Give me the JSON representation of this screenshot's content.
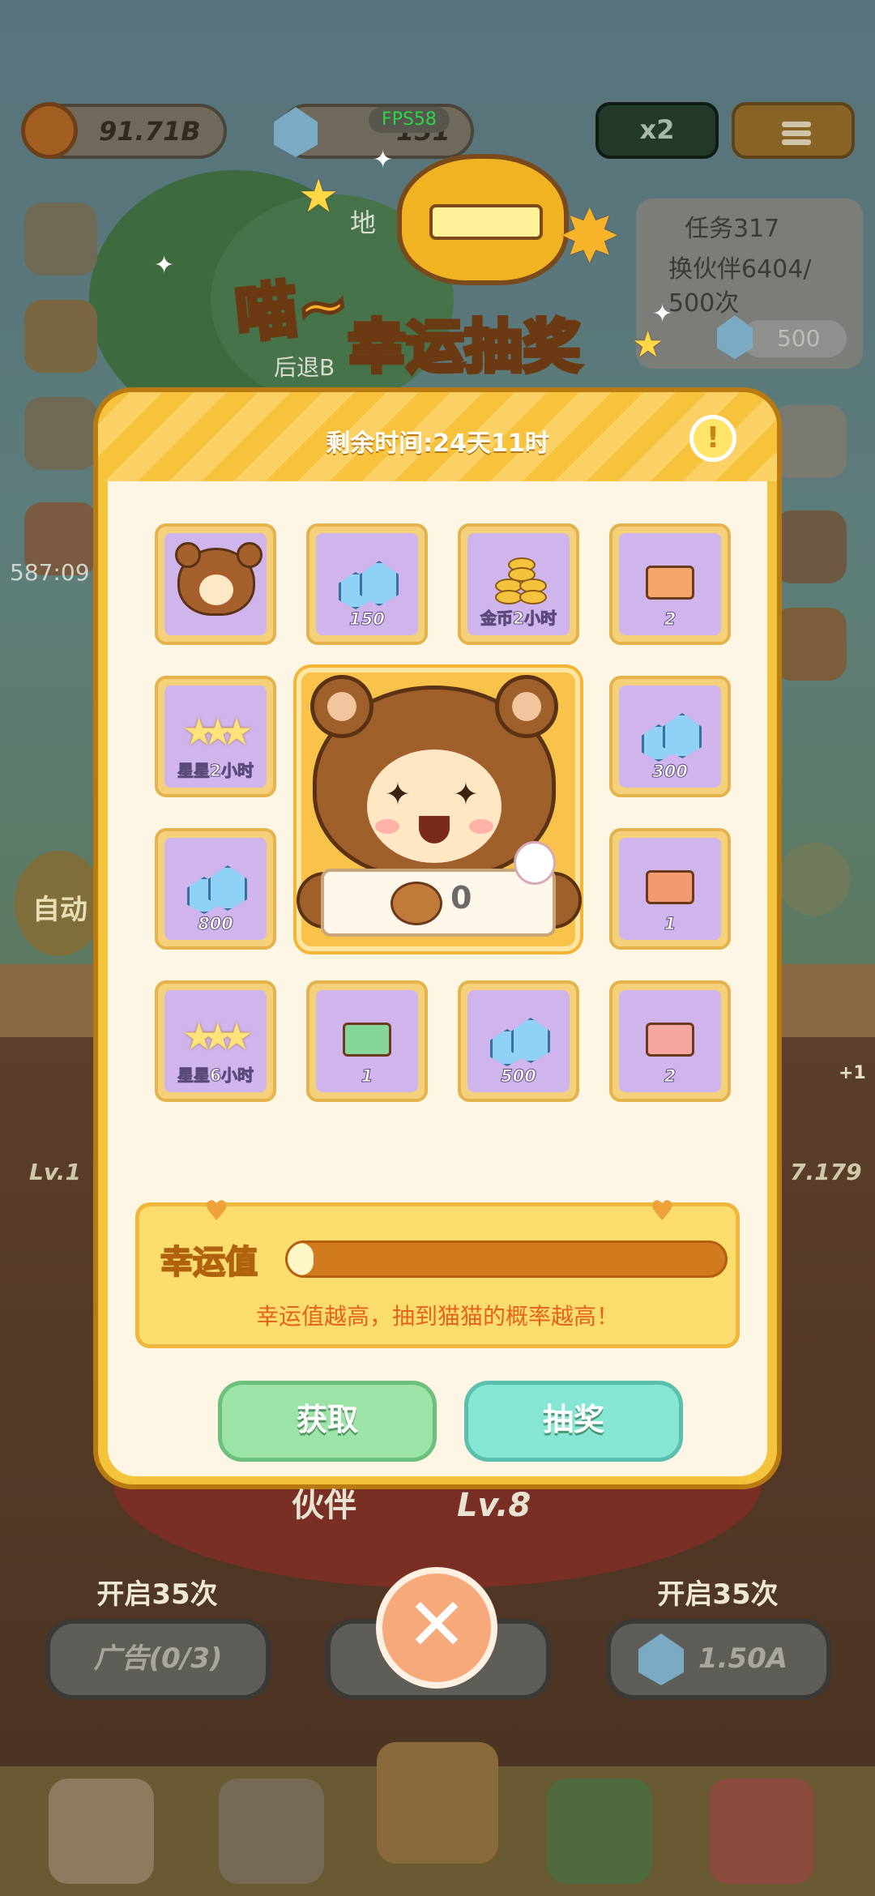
{
  "hud": {
    "coins": "91.71B",
    "gems": "151",
    "fps": "FPS58",
    "speed_label": "x2"
  },
  "task": {
    "title": "任务317",
    "line1": "换伙伴6404/",
    "line2": "500次",
    "reward": "500"
  },
  "background_fragments": {
    "left_text": "587:09",
    "partial_a": "地",
    "partial_b": "后退B",
    "partial_c": "自动",
    "level_left": "Lv.1",
    "value_right": "7.179",
    "plus_one": "+1"
  },
  "banner": {
    "meow": "喵~",
    "title": "幸运抽奖"
  },
  "modal": {
    "timer": "剩余时间:24天11时",
    "info_icon": "!",
    "rewards": [
      {
        "kind": "bear-costume",
        "label": ""
      },
      {
        "kind": "gems",
        "label": "150"
      },
      {
        "kind": "coins",
        "label": "金币2小时"
      },
      {
        "kind": "ticket-cat",
        "label": "2"
      },
      {
        "kind": "stars",
        "label": "星星2小时"
      },
      {
        "kind": "gems",
        "label": "300"
      },
      {
        "kind": "gems",
        "label": "800"
      },
      {
        "kind": "ticket-bread",
        "label": "1"
      },
      {
        "kind": "stars",
        "label": "星星6小时"
      },
      {
        "kind": "ticket-fish",
        "label": "1"
      },
      {
        "kind": "gems",
        "label": "500"
      },
      {
        "kind": "ticket-paw",
        "label": "2"
      }
    ],
    "center_prize_count": "0",
    "luck_label": "幸运值",
    "luck_progress": 0.06,
    "luck_desc": "幸运值越高，抽到猫猫的概率越高！",
    "obtain_button": "获取",
    "draw_button": "抽奖"
  },
  "behind": {
    "partner_label": "伙伴",
    "partner_level": "Lv.8",
    "open_left": "开启35次",
    "open_right": "开启35次",
    "ad_button": "广告(0/3)",
    "gem_button": "1.50A"
  },
  "colors": {
    "modal_border": "#b97a12",
    "modal_body": "#fdf6e4",
    "obtain_green": "#9be3a6",
    "draw_teal": "#86e6d4",
    "close_orange": "#f6a97a"
  }
}
